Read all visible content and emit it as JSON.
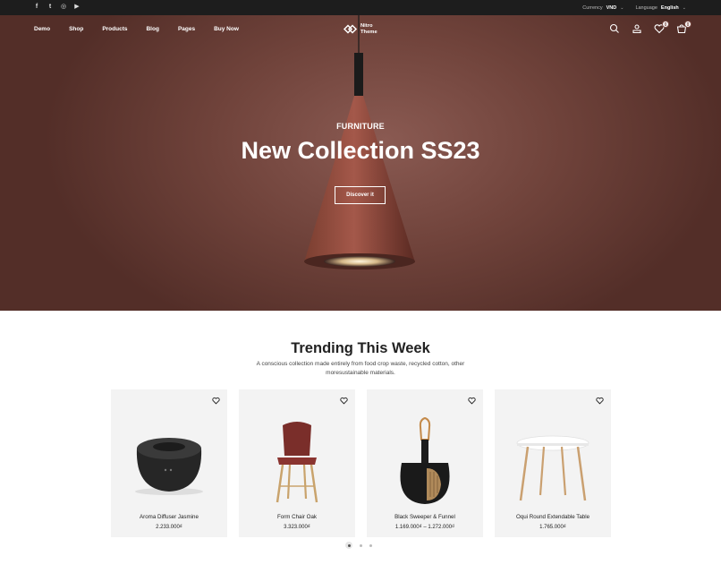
{
  "topbar": {
    "socials": [
      {
        "icon": "facebook-icon",
        "glyph": "f"
      },
      {
        "icon": "twitter-icon",
        "glyph": "t"
      },
      {
        "icon": "instagram-icon",
        "glyph": "◎"
      },
      {
        "icon": "youtube-icon",
        "glyph": "▶"
      }
    ],
    "currency_label": "Currency",
    "currency_value": "VND",
    "language_label": "Language",
    "language_value": "English"
  },
  "nav": {
    "items": [
      "Demo",
      "Shop",
      "Products",
      "Blog",
      "Pages",
      "Buy Now"
    ]
  },
  "logo": {
    "line1": "Nitro",
    "line2": "Theme"
  },
  "header_icons": {
    "wishlist_count": "0",
    "cart_count": "0"
  },
  "hero": {
    "subtitle": "FURNITURE",
    "title": "New Collection SS23",
    "button": "Discover it",
    "bg_color": "#70433b"
  },
  "trending": {
    "title": "Trending This Week",
    "description": "A conscious collection made entirely from food crop waste, recycled cotton, other moresustainable materials.",
    "products": [
      {
        "name": "Aroma Diffuser Jasmine",
        "price": "2.233.000₫",
        "image": "diffuser-image"
      },
      {
        "name": "Form Chair Oak",
        "price": "3.323.000₫",
        "image": "chair-image"
      },
      {
        "name": "Black Sweeper & Funnel",
        "price": "1.169.000₫ – 1.272.000₫",
        "image": "sweeper-image"
      },
      {
        "name": "Oqui Round Extendable Table",
        "price": "1.765.000₫",
        "image": "table-image"
      }
    ]
  },
  "carousel": {
    "active_page": 1,
    "pages": 3
  }
}
